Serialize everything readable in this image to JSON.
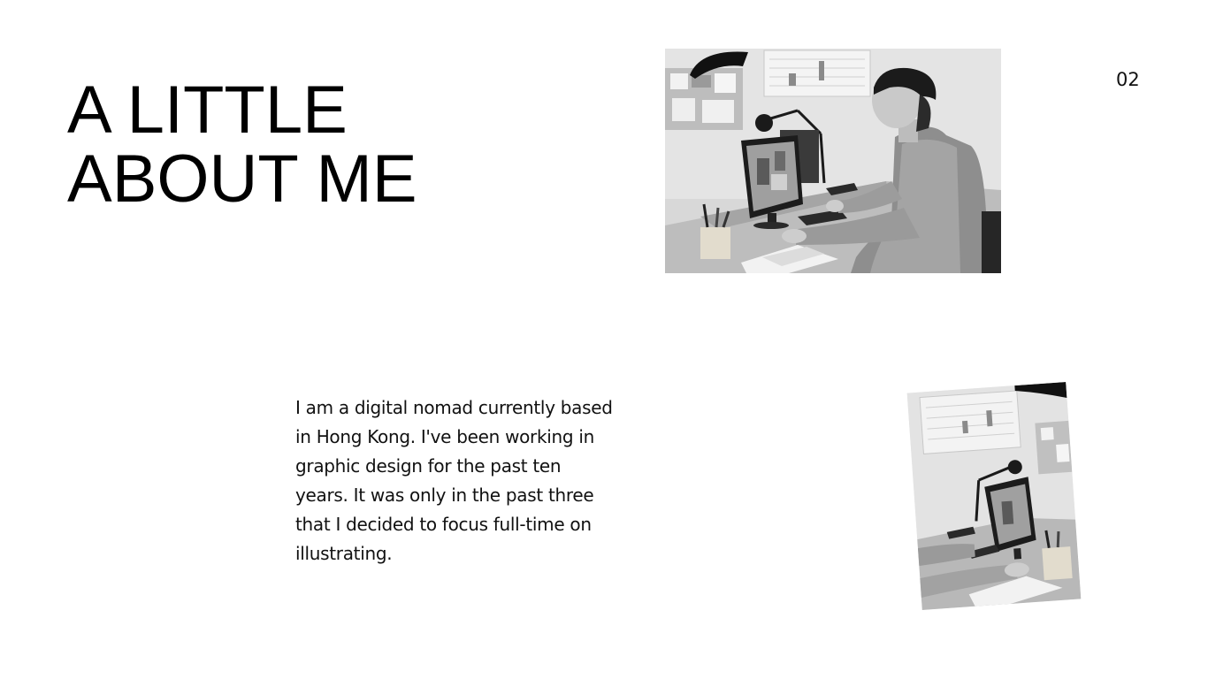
{
  "slide": {
    "title_line1": "A LITTLE",
    "title_line2": "ABOUT ME",
    "page_number": "02",
    "body": "I am a digital nomad currently based in Hong Kong. I've been working in graphic design for the past ten years. It was only in the past three that I decided to focus full-time on illustrating."
  },
  "images": {
    "main": {
      "subject": "man-working-at-computer-photo",
      "style": "black-and-white"
    },
    "secondary": {
      "subject": "desk-with-computer-photo",
      "style": "black-and-white"
    }
  },
  "colors": {
    "background": "#ffffff",
    "text": "#000000"
  }
}
